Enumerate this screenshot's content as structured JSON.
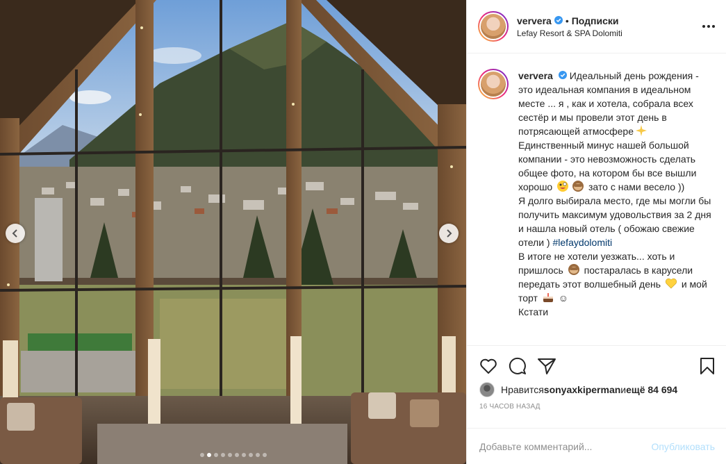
{
  "post": {
    "username": "ververa",
    "follow_label": "Подписки",
    "separator": "•",
    "location": "Lefay Resort & SPA Dolomiti",
    "caption": {
      "username": "ververa",
      "p1": "Идеальный день рождения - это идеальная компания в идеальном месте ... я , как и хотела, собрала всех сестёр и мы провели этот день в потрясающей атмосфере",
      "p2": " Единственный минус нашей большой компании - это невозможность сделать общее фото, на котором бы все вышли хорошо ",
      "p3": " зато с нами весело ))",
      "p4": "Я долго выбирала место, где мы могли бы получить максимум удовольствия за 2 дня и нашла новый отель ( обожаю свежие отели ) ",
      "hashtag": "#lefaydolomiti",
      "p5": "В итоге не хотели уезжать... хоть и пришлось ",
      "p6": " постаралась в карусели передать этот волшебный день ",
      "p7": " и мой торт ",
      "p8": " ☺",
      "p9": "Кстати"
    },
    "likes": {
      "prefix": "Нравится ",
      "liker": "sonyaxkiperman",
      "middle": " и ",
      "count": "ещё 84 694"
    },
    "timestamp": "16 часов назад",
    "comment_placeholder": "Добавьте комментарий...",
    "publish_label": "Опубликовать",
    "carousel": {
      "total": 10,
      "active": 2
    }
  },
  "colors": {
    "verified_blue": "#3897f0",
    "link_blue": "#00376b",
    "publish_disabled": "#b2dffc",
    "muted": "#8e8e8e"
  }
}
